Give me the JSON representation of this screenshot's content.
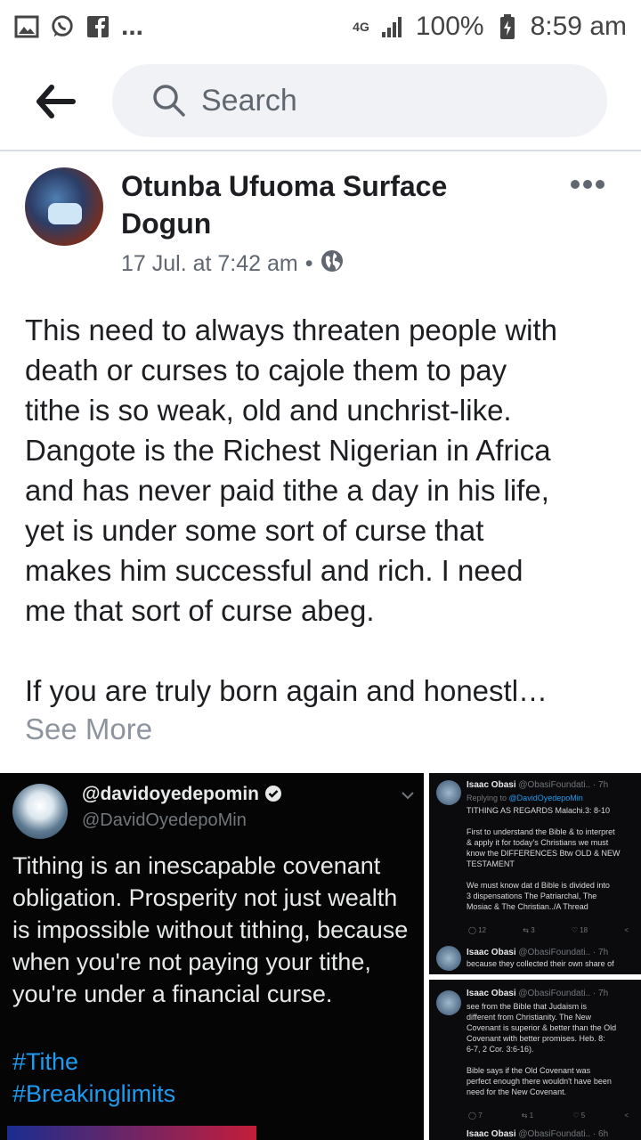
{
  "status": {
    "network": "4G",
    "battery": "100%",
    "time": "8:59 am",
    "dots": "..."
  },
  "search": {
    "placeholder": "Search"
  },
  "post": {
    "author": "Otunba Ufuoma Surface Dogun",
    "date": "17 Jul. at 7:42 am",
    "separator": "•",
    "body_lines": [
      "This need to always threaten people with",
      "death or curses to cajole them to pay",
      "tithe is so weak, old and unchrist-like.",
      "Dangote is the Richest Nigerian in Africa",
      "and has never paid tithe a day in his life,",
      "yet is under some sort of curse that",
      "makes him successful and rich. I need",
      "me that sort of curse abeg.",
      "",
      "If you are truly born again and honestl…"
    ],
    "see_more": "See More"
  },
  "tweet_main": {
    "name": "@davidoyedepomin",
    "handle": "@DavidOyedepoMin",
    "text": "Tithing is an inescapable covenant obligation. Prosperity not just wealth is impossible without tithing, because when you're not paying your tithe, you're under a financial curse.",
    "tags": [
      "#Tithe",
      "#Breakinglimits"
    ]
  },
  "tweet_r1": {
    "name": "Isaac Obasi",
    "meta": "@ObasiFoundati.. · 7h",
    "reply_prefix": "Replying to",
    "reply_to": "@DavidOyedepoMin",
    "lines": [
      "TITHING AS REGARDS Malachi.3: 8-10",
      "",
      "First to understand the Bible & to interpret",
      "& apply it for today's Christians we must",
      "know the DIFFERENCES Btw OLD & NEW",
      "TESTAMENT",
      "",
      "We must know dat d Bible is divided into",
      "3 dispensations The Patriarchal, The",
      "Mosiac & The Christian../A Thread"
    ],
    "actions": [
      "12",
      "3",
      "18",
      ""
    ],
    "next_name": "Isaac Obasi",
    "next_meta": "@ObasiFoundati.. · 7h",
    "next_text": "because they collected their own share of"
  },
  "tweet_r2": {
    "name": "Isaac Obasi",
    "meta": "@ObasiFoundati.. · 7h",
    "lines": [
      "see from the Bible that Judaism is",
      "different from Christianity. The New",
      "Covenant is superior & better than the Old",
      "Covenant with better promises. Heb. 8:",
      "6-7, 2 Cor. 3:6-16).",
      "",
      "Bible says if the Old Covenant was",
      "perfect enough there wouldn't have been",
      "need for the New Covenant."
    ],
    "actions": [
      "7",
      "1",
      "5",
      ""
    ],
    "next_name": "Isaac Obasi",
    "next_meta": "@ObasiFoundati.. · 6h"
  }
}
